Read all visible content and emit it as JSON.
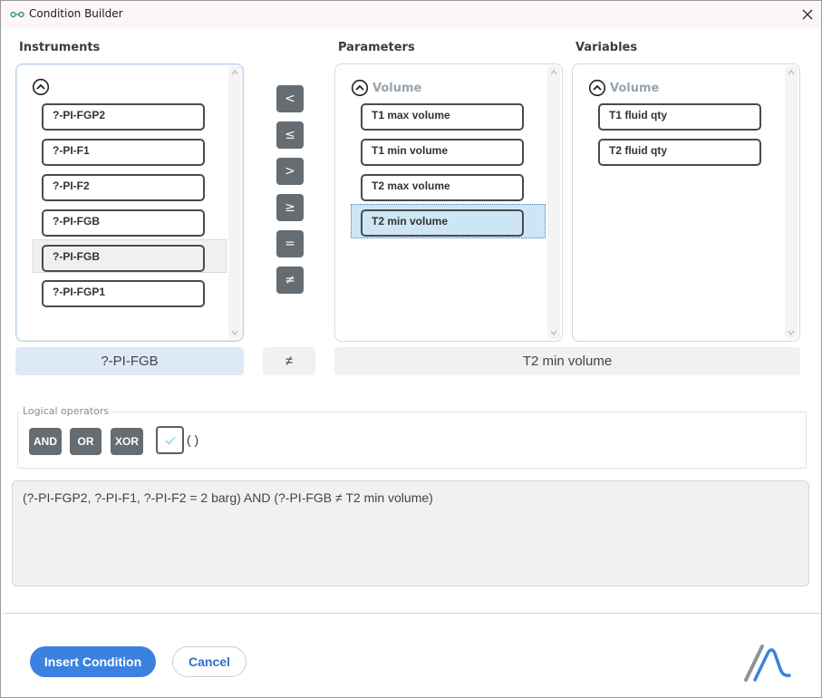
{
  "window": {
    "title": "Condition Builder"
  },
  "instruments": {
    "label": "Instruments",
    "items": [
      "?-PI-FGP2",
      "?-PI-F1",
      "?-PI-F2",
      "?-PI-FGB",
      "?-PI-FGB",
      "?-PI-FGP1"
    ],
    "selected_value": "?-PI-FGB"
  },
  "operators": {
    "items": [
      "<",
      "≤",
      ">",
      "≥",
      "=",
      "≠"
    ],
    "selected_value": "≠"
  },
  "parameters": {
    "label": "Parameters",
    "group": "Volume",
    "items": [
      "T1 max volume",
      "T1 min volume",
      "T2 max volume",
      "T2 min volume"
    ],
    "selected_value": "T2 min volume"
  },
  "variables": {
    "label": "Variables",
    "group": "Volume",
    "items": [
      "T1 fluid qty",
      "T2 fluid qty"
    ]
  },
  "logical": {
    "label": "Logical operators",
    "and": "AND",
    "or": "OR",
    "xor": "XOR",
    "parens_label": "( )"
  },
  "expression": "(?-PI-FGP2, ?-PI-F1, ?-PI-F2 = 2 barg) AND (?-PI-FGB ≠ T2 min volume)",
  "footer": {
    "insert_label": "Insert Condition",
    "cancel_label": "Cancel"
  },
  "colors": {
    "accent": "#3b82e0",
    "operator_button": "#656c72",
    "selection": "#cde6f6",
    "instrument_field": "#dde9f7"
  }
}
